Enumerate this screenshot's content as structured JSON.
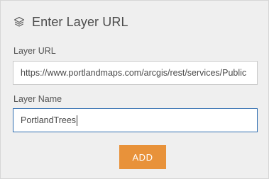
{
  "dialog": {
    "title": "Enter Layer URL",
    "icon": "layers-icon"
  },
  "layer_url": {
    "label": "Layer URL",
    "value": "https://www.portlandmaps.com/arcgis/rest/services/Public"
  },
  "layer_name": {
    "label": "Layer Name",
    "value": "PortlandTrees"
  },
  "add_button": {
    "label": "ADD",
    "color": "#e8923a"
  },
  "colors": {
    "panel_bg": "#efefef",
    "focus_border": "#2e6cb0"
  }
}
